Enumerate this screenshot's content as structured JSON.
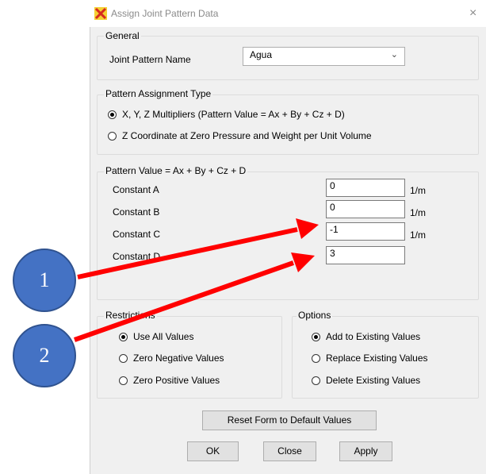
{
  "window": {
    "title": "Assign Joint Pattern Data",
    "close_glyph": "×"
  },
  "general": {
    "legend": "General",
    "name_label": "Joint Pattern Name",
    "name_value": "Agua"
  },
  "assignment_type": {
    "legend": "Pattern Assignment Type",
    "options": [
      {
        "label": "X, Y, Z Multipliers  (Pattern Value = Ax + By + Cz + D)",
        "selected": true
      },
      {
        "label": "Z Coordinate at Zero Pressure and Weight per Unit Volume",
        "selected": false
      }
    ]
  },
  "pattern_value": {
    "legend": "Pattern Value = Ax + By + Cz + D",
    "constants": [
      {
        "label": "Constant A",
        "value": "0",
        "unit": "1/m"
      },
      {
        "label": "Constant B",
        "value": "0",
        "unit": "1/m"
      },
      {
        "label": "Constant C",
        "value": "-1",
        "unit": "1/m"
      },
      {
        "label": "Constant D",
        "value": "3",
        "unit": ""
      }
    ]
  },
  "restrictions": {
    "legend": "Restrictions",
    "options": [
      {
        "label": "Use All Values",
        "selected": true
      },
      {
        "label": "Zero Negative Values",
        "selected": false
      },
      {
        "label": "Zero Positive Values",
        "selected": false
      }
    ]
  },
  "options_group": {
    "legend": "Options",
    "options": [
      {
        "label": "Add to Existing Values",
        "selected": true
      },
      {
        "label": "Replace Existing Values",
        "selected": false
      },
      {
        "label": "Delete Existing Values",
        "selected": false
      }
    ]
  },
  "buttons": {
    "reset": "Reset Form to Default Values",
    "ok": "OK",
    "close": "Close",
    "apply": "Apply"
  },
  "annotations": [
    {
      "label": "1"
    },
    {
      "label": "2"
    }
  ],
  "colors": {
    "arrow": "#ff0000",
    "circle_fill": "#4472c4",
    "circle_border": "#2f528f"
  }
}
